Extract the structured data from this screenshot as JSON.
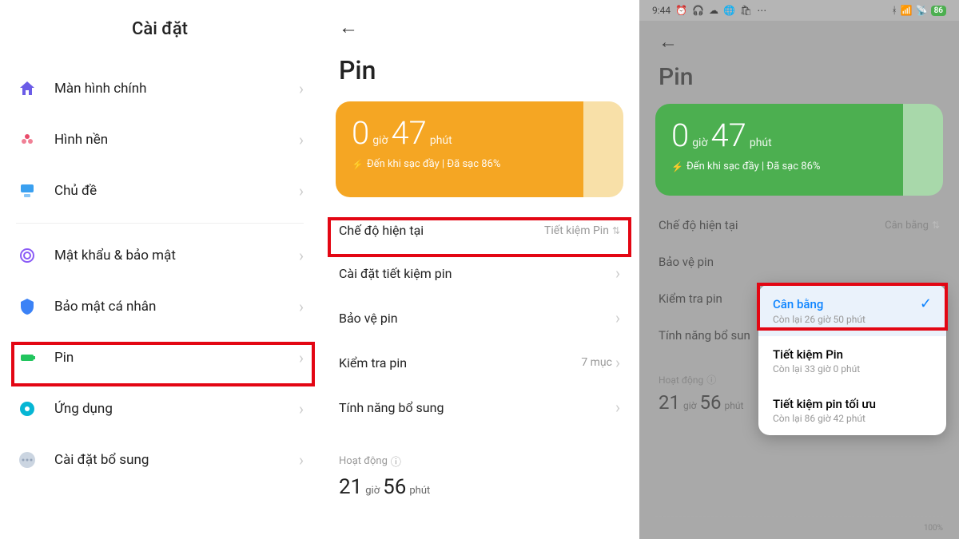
{
  "screen1": {
    "title": "Cài đặt",
    "items": [
      {
        "icon": "home",
        "color": "#6b5ce7",
        "label": "Màn hình chính"
      },
      {
        "icon": "flower",
        "color": "#e94b6a",
        "label": "Hình nền"
      },
      {
        "icon": "theme",
        "color": "#3aa0f0",
        "label": "Chủ đề"
      }
    ],
    "items2": [
      {
        "icon": "fingerprint",
        "color": "#8b5cf6",
        "label": "Mật khẩu & bảo mật"
      },
      {
        "icon": "shield",
        "color": "#3b82f6",
        "label": "Bảo mật cá nhân"
      },
      {
        "icon": "battery",
        "color": "#22c55e",
        "label": "Pin"
      },
      {
        "icon": "apps",
        "color": "#06b6d4",
        "label": "Ứng dụng"
      },
      {
        "icon": "more",
        "color": "#94a3b8",
        "label": "Cài đặt bổ sung"
      }
    ]
  },
  "screen2": {
    "title": "Pin",
    "battery": {
      "hours": "0",
      "hours_unit": "giờ",
      "minutes": "47",
      "minutes_unit": "phút",
      "subtitle": "Đến khi sạc đầy | Đã sạc 86%"
    },
    "items": [
      {
        "label": "Chế độ hiện tại",
        "value": "Tiết kiệm Pin",
        "sort": true
      },
      {
        "label": "Cài đặt tiết kiệm pin",
        "value": "",
        "arrow": true
      },
      {
        "label": "Bảo vệ pin",
        "value": "",
        "arrow": true
      },
      {
        "label": "Kiểm tra pin",
        "value": "7 mục",
        "arrow": true
      },
      {
        "label": "Tính năng bổ sung",
        "value": "",
        "arrow": true
      }
    ],
    "activity": {
      "label": "Hoạt động",
      "hours": "21",
      "hours_unit": "giờ",
      "minutes": "56",
      "minutes_unit": "phút"
    }
  },
  "screen3": {
    "status": {
      "time": "9:44",
      "battery_pct": "86"
    },
    "title": "Pin",
    "battery": {
      "hours": "0",
      "hours_unit": "giờ",
      "minutes": "47",
      "minutes_unit": "phút",
      "subtitle": "Đến khi sạc đầy | Đã sạc 86%"
    },
    "items": [
      {
        "label": "Chế độ hiện tại",
        "value": "Cân bằng"
      },
      {
        "label": "Bảo vệ pin"
      },
      {
        "label": "Kiểm tra pin"
      },
      {
        "label": "Tính năng bổ sun"
      }
    ],
    "popup": [
      {
        "title": "Cân bằng",
        "sub": "Còn lại 26 giờ 50 phút",
        "selected": true
      },
      {
        "title": "Tiết kiệm Pin",
        "sub": "Còn lại 33 giờ 0 phút"
      },
      {
        "title": "Tiết kiệm pin tối ưu",
        "sub": "Còn lại 86 giờ 42 phút"
      }
    ],
    "activity": {
      "label": "Hoạt động",
      "hours": "21",
      "hours_unit": "giờ",
      "minutes": "56",
      "minutes_unit": "phút"
    },
    "pct_label": "100%"
  }
}
